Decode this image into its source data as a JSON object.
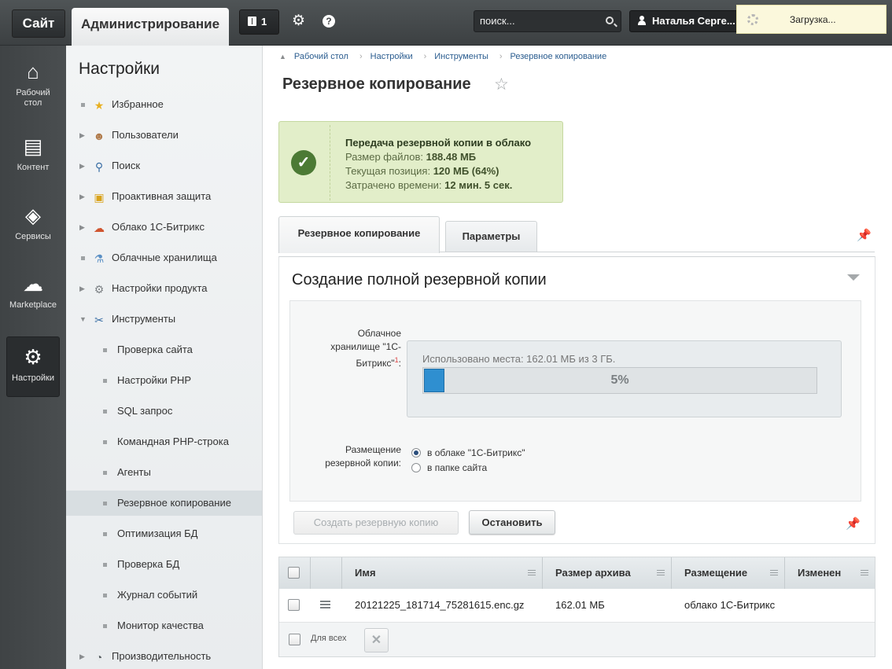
{
  "topbar": {
    "site": "Сайт",
    "admin": "Администрирование",
    "notifications_count": "1",
    "search_placeholder": "поиск...",
    "user": "Наталья Серге...",
    "loading": "Загрузка..."
  },
  "leftnav": [
    {
      "label": "Рабочий стол",
      "icon": "home-icon"
    },
    {
      "label": "Контент",
      "icon": "document-icon"
    },
    {
      "label": "Сервисы",
      "icon": "layers-icon"
    },
    {
      "label": "Marketplace",
      "icon": "cloud-download-icon"
    },
    {
      "label": "Настройки",
      "icon": "gear-icon",
      "active": true
    }
  ],
  "menu": {
    "title": "Настройки",
    "items": [
      {
        "label": "Избранное",
        "icon": "star-icon"
      },
      {
        "label": "Пользователи",
        "icon": "user-icon"
      },
      {
        "label": "Поиск",
        "icon": "search-icon"
      },
      {
        "label": "Проактивная защита",
        "icon": "lock-icon"
      },
      {
        "label": "Облако 1С-Битрикс",
        "icon": "cloud-icon"
      },
      {
        "label": "Облачные хранилища",
        "icon": "flask-icon"
      },
      {
        "label": "Настройки продукта",
        "icon": "cog-icon"
      },
      {
        "label": "Инструменты",
        "icon": "tools-icon"
      }
    ],
    "subitems": [
      "Проверка сайта",
      "Настройки PHP",
      "SQL запрос",
      "Командная PHP-строка",
      "Агенты",
      "Резервное копирование",
      "Оптимизация БД",
      "Проверка БД",
      "Журнал событий",
      "Монитор качества"
    ],
    "last_item": "Производительность",
    "selected_subitem": "Резервное копирование"
  },
  "breadcrumbs": [
    "Рабочий стол",
    "Настройки",
    "Инструменты",
    "Резервное копирование"
  ],
  "page_title": "Резервное копирование",
  "message": {
    "title": "Передача резервной копии в облако",
    "size_label": "Размер файлов:",
    "size_value": "188.48 МБ",
    "pos_label": "Текущая позиция:",
    "pos_value": "120 МБ (64%)",
    "time_label": "Затрачено времени:",
    "time_value": "12 мин. 5 сек."
  },
  "tabs": [
    "Резервное копирование",
    "Параметры"
  ],
  "panel": {
    "title": "Создание полной резервной копии",
    "cloud_label": "Облачное хранилище \"1С-Битрикс\"",
    "cloud_sup": "1",
    "cloud_colon": ":",
    "quota_text": "Использовано места: 162.01 МБ из 3 ГБ.",
    "quota_percent": 5,
    "quota_percent_label": "5%",
    "placement_label": "Размещение резервной копии:",
    "options": [
      "в облаке \"1С-Битрикс\"",
      "в папке сайта"
    ],
    "selected_option": 0,
    "create_button": "Создать резервную копию",
    "stop_button": "Остановить"
  },
  "table": {
    "columns": [
      "Имя",
      "Размер архива",
      "Размещение",
      "Изменен"
    ],
    "rows": [
      {
        "name": "20121225_181714_75281615.enc.gz",
        "size": "162.01 МБ",
        "place": "облако 1С-Битрикс",
        "modified": ""
      }
    ],
    "footer_label": "Для всех"
  },
  "colors": {
    "accent_blue": "#2f8fd0",
    "success_green": "#4c7a35",
    "message_bg": "#e2eec9"
  }
}
